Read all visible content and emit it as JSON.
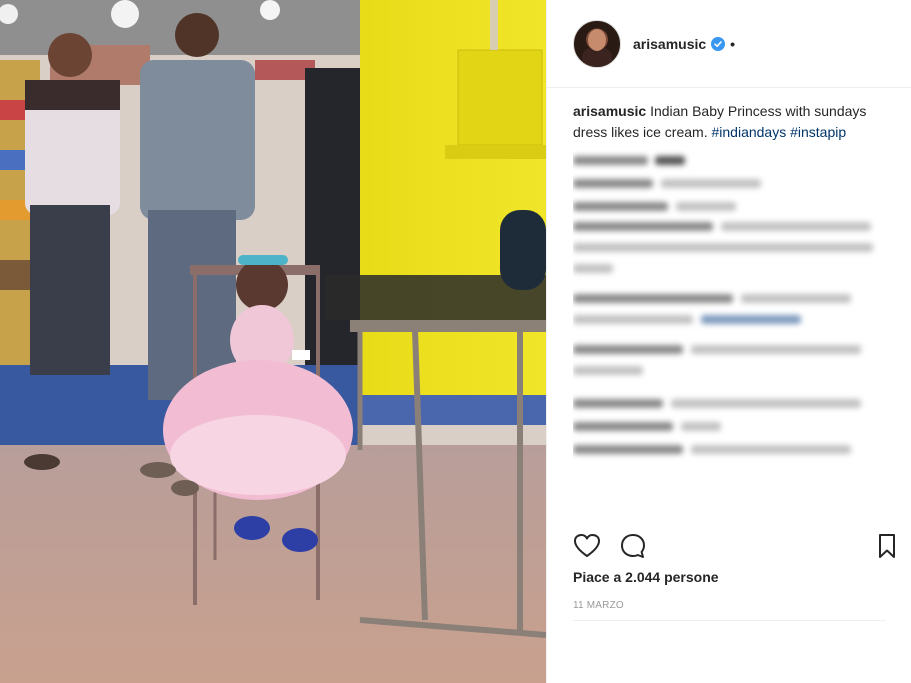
{
  "post": {
    "username": "arisamusic",
    "separator": "•",
    "caption_text": "Indian Baby Princess with sundays dress likes ice cream.",
    "hashtags": [
      "#indiandays",
      "#instapip"
    ],
    "likes_text": "Piace a 2.044 persone",
    "date": "11 MARZO"
  },
  "icons": {
    "verified": "verified-badge-icon",
    "like": "heart-icon",
    "comment": "comment-bubble-icon",
    "save": "bookmark-icon"
  },
  "colors": {
    "accent_blue": "#3897f0",
    "hashtag": "#003569",
    "text": "#262626",
    "muted": "#999999"
  }
}
